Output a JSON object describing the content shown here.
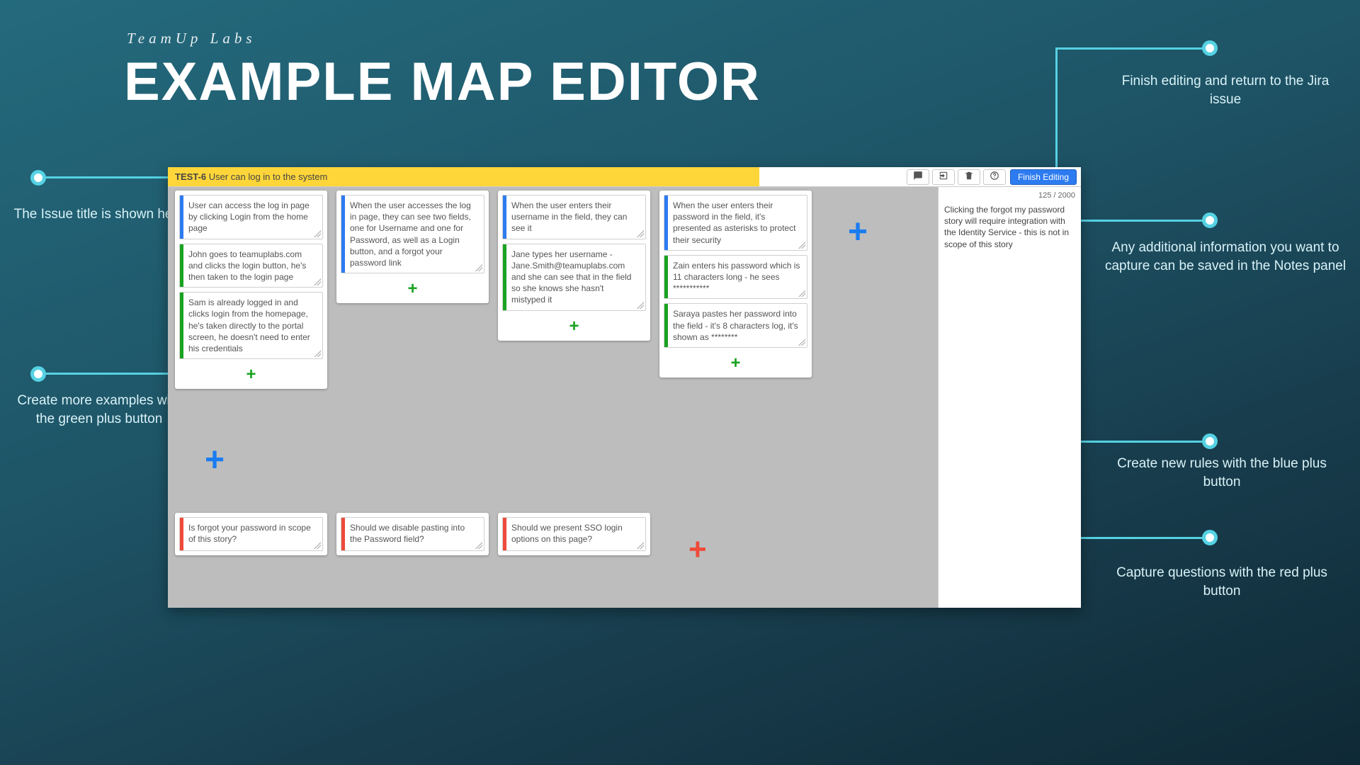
{
  "brand": "TeamUp Labs",
  "heading": "EXAMPLE MAP EDITOR",
  "annotations": {
    "issue_title": "The Issue title is shown here",
    "green_plus": "Create more examples with the green plus button",
    "finish": "Finish editing and return to the Jira issue",
    "notes": "Any additional information you want to capture can be saved in the Notes panel",
    "blue_plus": "Create new rules with the blue plus button",
    "red_plus": "Capture questions with the red plus button"
  },
  "app": {
    "issue_key": "TEST-6",
    "issue_title": "User can log in to the system",
    "finish_label": "Finish Editing",
    "notes_count": "125 / 2000",
    "notes_text": "Clicking the forgot my password story will require integration with the Identity Service - this is not in scope of this story",
    "columns": [
      {
        "rule": "User can access the log in page by clicking Login from the home page",
        "examples": [
          "John goes to teamuplabs.com and clicks the login button, he's then taken to the login page",
          "Sam is already logged in and clicks login from the homepage, he's taken directly to the portal screen, he doesn't need to enter his credentials"
        ]
      },
      {
        "rule": "When the user accesses the log in page, they can see two fields, one for Username and one for Password, as well as a Login button, and a forgot your password link",
        "examples": []
      },
      {
        "rule": "When the user enters their username in the field, they can see it",
        "examples": [
          "Jane types her username - Jane.Smith@teamuplabs.com and she can see that in the field so she knows she hasn't mistyped it"
        ]
      },
      {
        "rule": "When the user enters their password in the field, it's presented as asterisks to protect their security",
        "examples": [
          "Zain enters his password which is 11 characters long - he sees ***********",
          "Saraya pastes her password into the field - it's 8 characters log, it's shown as ********"
        ]
      }
    ],
    "questions": [
      "Is forgot your password in scope of this story?",
      "Should we disable pasting into the Password field?",
      "Should we present SSO login options on this page?"
    ]
  }
}
